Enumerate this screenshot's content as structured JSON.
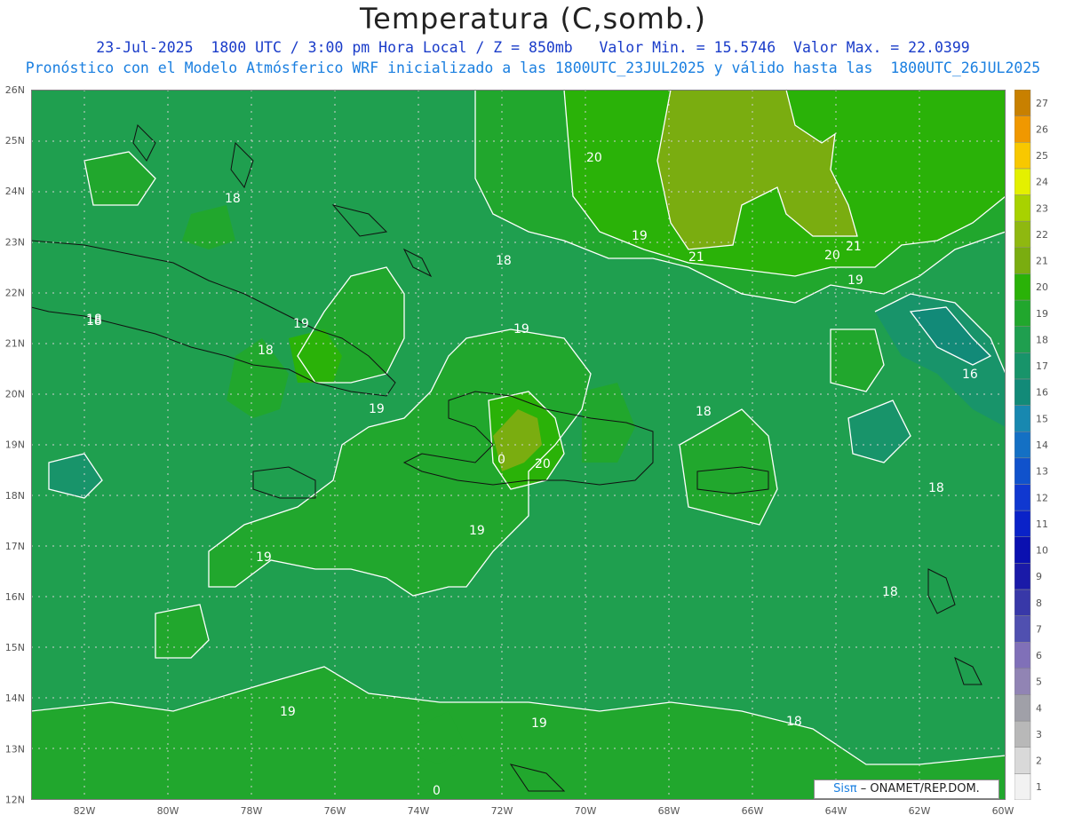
{
  "header": {
    "title": "Temperatura (C,somb.)",
    "subtitle1": "23-Jul-2025  1800 UTC / 3:00 pm Hora Local / Z = 850mb   Valor Min. = 15.5746  Valor Max. = 22.0399",
    "subtitle2": "Pronóstico con el Modelo Atmósferico WRF inicializado a las 1800UTC_23JUL2025 y válido hasta las  1800UTC_26JUL2025"
  },
  "axes": {
    "lat_labels": [
      "26N",
      "25N",
      "24N",
      "23N",
      "22N",
      "21N",
      "20N",
      "19N",
      "18N",
      "17N",
      "16N",
      "15N",
      "14N",
      "13N",
      "12N"
    ],
    "lon_labels": [
      "82W",
      "80W",
      "78W",
      "76W",
      "74W",
      "72W",
      "70W",
      "68W",
      "66W",
      "64W",
      "62W",
      "60W"
    ]
  },
  "colorbar": {
    "levels": [
      "1",
      "2",
      "3",
      "4",
      "5",
      "6",
      "7",
      "8",
      "9",
      "10",
      "11",
      "12",
      "13",
      "14",
      "15",
      "16",
      "17",
      "18",
      "19",
      "20",
      "21",
      "22",
      "23",
      "24",
      "25",
      "26",
      "27"
    ],
    "colors": [
      "#f2f2f2",
      "#d9d9d9",
      "#b8b8b8",
      "#a0a0a8",
      "#9184b4",
      "#8070b8",
      "#5050b0",
      "#3838a8",
      "#1a1aa8",
      "#0a10b0",
      "#0a22c8",
      "#1038d0",
      "#1052cc",
      "#1470c4",
      "#1888b0",
      "#128a78",
      "#18946a",
      "#1f9f4f",
      "#21a72d",
      "#2ab208",
      "#7aad10",
      "#8fb810",
      "#a8d200",
      "#e4f000",
      "#f8c800",
      "#f09800",
      "#c88000"
    ]
  },
  "contour_labels": [
    {
      "text": "18"
    },
    {
      "text": "18"
    },
    {
      "text": "18"
    },
    {
      "text": "19"
    },
    {
      "text": "18"
    },
    {
      "text": "19"
    },
    {
      "text": "18"
    },
    {
      "text": "19"
    },
    {
      "text": "20"
    },
    {
      "text": "19"
    },
    {
      "text": "21"
    },
    {
      "text": "21"
    },
    {
      "text": "20"
    },
    {
      "text": "19"
    },
    {
      "text": "16"
    },
    {
      "text": "18"
    },
    {
      "text": "20"
    },
    {
      "text": "0"
    },
    {
      "text": "19"
    },
    {
      "text": "19"
    },
    {
      "text": "18"
    },
    {
      "text": "18"
    },
    {
      "text": "19"
    },
    {
      "text": "19"
    },
    {
      "text": "18"
    },
    {
      "text": "0"
    }
  ],
  "credit": {
    "brand": "Sisπ",
    "text": "– ONAMET/REP.DOM."
  }
}
